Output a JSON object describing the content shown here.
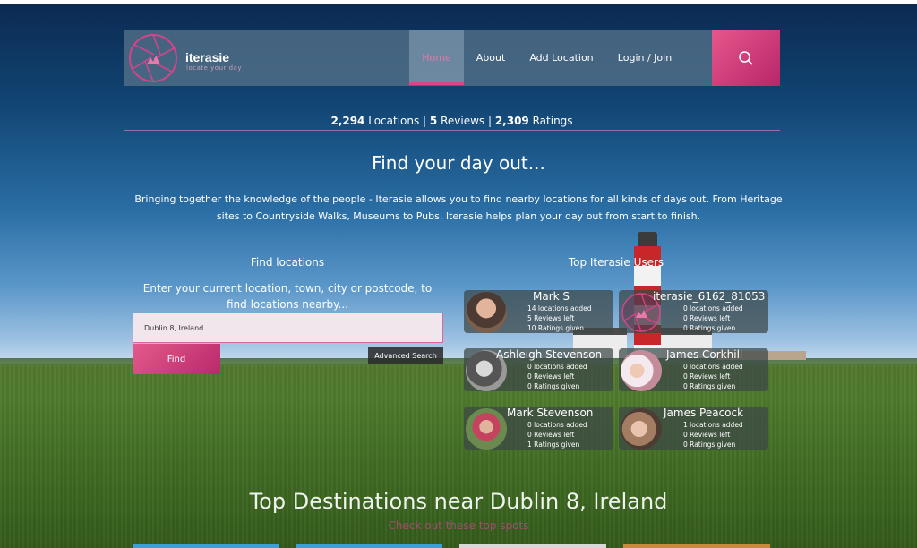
{
  "brand": {
    "name": "iterasie",
    "tagline": "locate your day"
  },
  "nav": {
    "items": [
      "Home",
      "About",
      "Add Location",
      "Login / Join"
    ]
  },
  "stats": {
    "locations": "2,294",
    "locations_label": " Locations | ",
    "reviews": "5",
    "reviews_label": " Reviews | ",
    "ratings": "2,309",
    "ratings_label": " Ratings"
  },
  "hero": {
    "title": "Find your day out...",
    "description": "Bringing together the knowledge of the people - Iterasie allows you to find nearby locations for all kinds of days out. From Heritage sites to Countryside Walks, Museums to Pubs. Iterasie helps plan your day out from start to finish."
  },
  "find": {
    "title": "Find locations",
    "prompt": "Enter your current location, town, city or postcode, to find locations nearby...",
    "input_value": "Dublin 8, Ireland",
    "find_button": "Find",
    "advanced_button": "Advanced Search"
  },
  "users": {
    "title": "Top Iterasie Users",
    "list": [
      {
        "name": "Mark S",
        "locations": "14 locations added",
        "reviews": "5 Reviews left",
        "ratings": "10 Ratings given"
      },
      {
        "name": "iterasie_6162_81053",
        "locations": "0 locations added",
        "reviews": "0 Reviews left",
        "ratings": "0 Ratings given"
      },
      {
        "name": "Ashleigh Stevenson",
        "locations": "0 locations added",
        "reviews": "0 Reviews left",
        "ratings": "0 Ratings given"
      },
      {
        "name": "James Corkhill",
        "locations": "0 locations added",
        "reviews": "0 Reviews left",
        "ratings": "0 Ratings given"
      },
      {
        "name": "Mark Stevenson",
        "locations": "0 locations added",
        "reviews": "0 Reviews left",
        "ratings": "1 Ratings given"
      },
      {
        "name": "James Peacock",
        "locations": "1 locations added",
        "reviews": "0 Reviews left",
        "ratings": "0 Ratings given"
      }
    ]
  },
  "destinations": {
    "title": "Top Destinations near Dublin 8, Ireland",
    "subtitle": "Check out these top spots"
  },
  "colors": {
    "accent": "#d94683",
    "accent_dark": "#b8296a"
  }
}
